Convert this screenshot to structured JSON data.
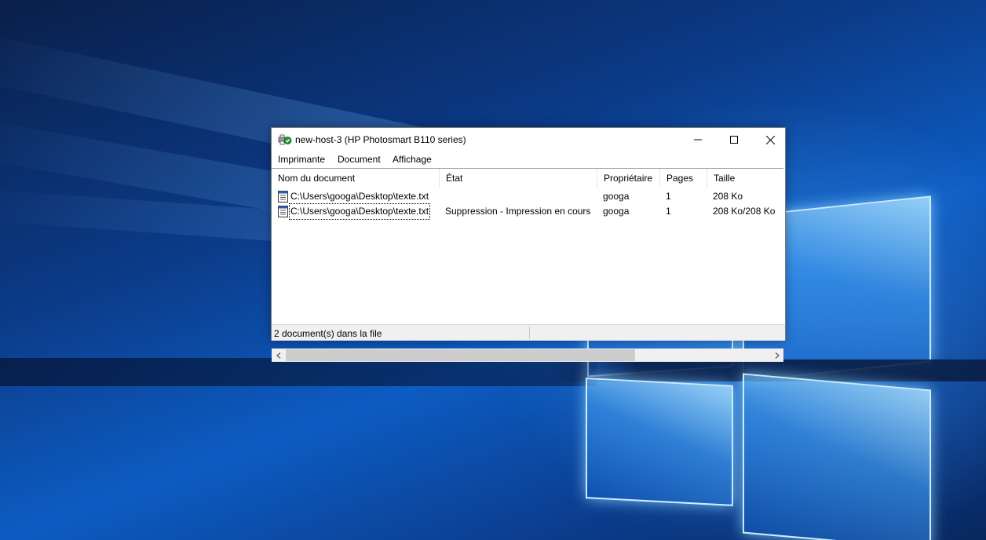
{
  "window": {
    "title": "new-host-3 (HP Photosmart B110 series)",
    "icon": "printer-icon"
  },
  "menu": {
    "items": [
      "Imprimante",
      "Document",
      "Affichage"
    ]
  },
  "table": {
    "columns": [
      "Nom du document",
      "État",
      "Propriétaire",
      "Pages",
      "Taille"
    ],
    "rows": [
      {
        "name": "C:\\Users\\googa\\Desktop\\texte.txt",
        "status": "",
        "owner": "googa",
        "pages": "1",
        "size": "208 Ko"
      },
      {
        "name": "C:\\Users\\googa\\Desktop\\texte.txt",
        "status": "Suppression - Impression en cours",
        "owner": "googa",
        "pages": "1",
        "size": "208 Ko/208 Ko"
      }
    ]
  },
  "status": {
    "text": "2 document(s) dans la file"
  },
  "colors": {
    "window_bg": "#ffffff",
    "status_bg": "#f0f0f0",
    "desktop_blue": "#0d5cc2"
  }
}
